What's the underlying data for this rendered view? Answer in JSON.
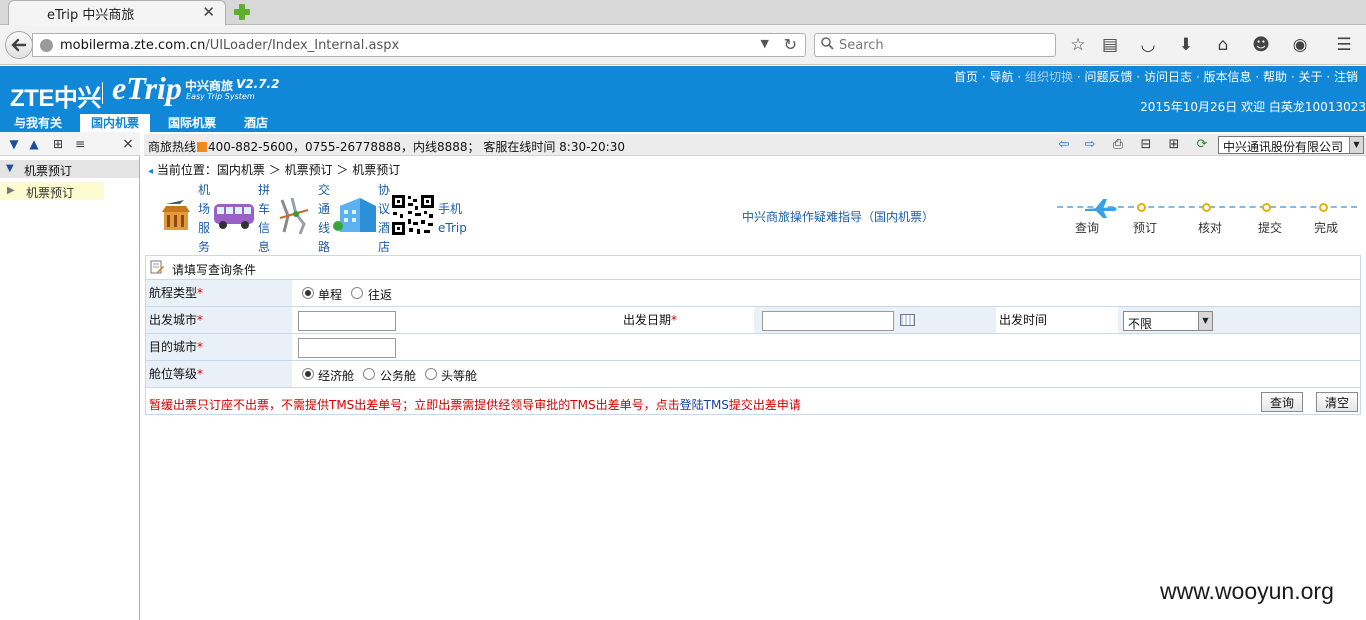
{
  "browser": {
    "tab_title": "eTrip 中兴商旅",
    "url_host": "mobilerma.zte.com.cn",
    "url_path": "/UILoader/Index_Internal.aspx",
    "search_placeholder": "Search"
  },
  "header": {
    "logo_zte": "ZTE中兴",
    "logo_etrip": "eTrip",
    "brand_name": "中兴商旅",
    "brand_version": "V2.7.2",
    "brand_subtitle": "Easy Trip System",
    "top_links": [
      "首页",
      "导航",
      "组织切换",
      "问题反馈",
      "访问日志",
      "版本信息",
      "帮助",
      "关于",
      "注销"
    ],
    "top_link_sep": "·",
    "date_text": "2015年10月26日",
    "welcome_text": "欢迎 白英龙10013023",
    "nav_tabs": [
      {
        "label": "与我有关"
      },
      {
        "label": "国内机票",
        "active": true
      },
      {
        "label": "国际机票"
      },
      {
        "label": "酒店"
      }
    ]
  },
  "sidebar": {
    "header_label": "机票预订",
    "items": [
      {
        "label": "机票预订"
      }
    ],
    "close_glyph": "×"
  },
  "infobar": {
    "hotline_label": "商旅热线",
    "hotline_text": "400-882-5600，0755-26778888，内线8888；  客服在线时间 8:30-20:30",
    "company": "中兴通讯股份有限公司"
  },
  "breadcrumb": {
    "prefix": "当前位置：",
    "items": [
      "国内机票",
      "机票预订",
      "机票预订"
    ],
    "sep": "＞"
  },
  "quicklinks": [
    {
      "label": "机场服务"
    },
    {
      "label": "拼车信息"
    },
    {
      "label": "交通线路"
    },
    {
      "label": "协议酒店"
    },
    {
      "label": "手机eTrip",
      "lines": [
        "手机",
        "eTrip"
      ]
    }
  ],
  "guide_link": "中兴商旅操作疑难指导（国内机票）",
  "progress_steps": [
    "查询",
    "预订",
    "核对",
    "提交",
    "完成"
  ],
  "form": {
    "title": "请填写查询条件",
    "trip_type_label": "航程类型",
    "trip_type_options": [
      {
        "label": "单程",
        "checked": true
      },
      {
        "label": "往返",
        "checked": false
      }
    ],
    "depart_city_label": "出发城市",
    "depart_city_value": "",
    "depart_date_label": "出发日期",
    "depart_date_value": "",
    "depart_time_label": "出发时间",
    "depart_time_value": "不限",
    "dest_city_label": "目的城市",
    "dest_city_value": "",
    "cabin_label": "舱位等级",
    "cabin_options": [
      {
        "label": "经济舱",
        "checked": true
      },
      {
        "label": "公务舱",
        "checked": false
      },
      {
        "label": "头等舱",
        "checked": false
      }
    ],
    "required_mark": "*",
    "notice_text": "暂缓出票只订座不出票，不需提供TMS出差单号；立即出票需提供经领导审批的TMS出差单号，点击",
    "notice_link": "登陆TMS",
    "notice_tail": "提交出差申请",
    "query_button": "查询",
    "clear_button": "清空"
  },
  "watermark": "www.wooyun.org",
  "colors": {
    "brand_blue": "#1187d8",
    "required_red": "#d40000",
    "link_blue": "#1a5ea8",
    "label_bg": "#eaf0f8"
  }
}
